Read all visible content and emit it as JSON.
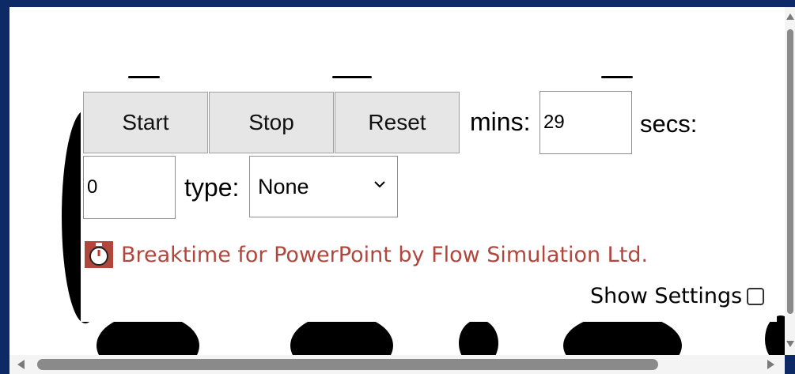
{
  "controls": {
    "start_label": "Start",
    "stop_label": "Stop",
    "reset_label": "Reset",
    "mins_label": "mins:",
    "mins_value": "29",
    "secs_label": "secs:",
    "secs_value": "0",
    "type_label": "type:",
    "type_selected": "None"
  },
  "credit": {
    "text": "Breaktime for PowerPoint by Flow Simulation Ltd.",
    "icon": "stopwatch-icon",
    "color": "#b0463c"
  },
  "settings": {
    "label": "Show Settings",
    "checked": false
  },
  "colors": {
    "frame_border": "#0e2a66",
    "button_bg": "#e6e6e6"
  }
}
